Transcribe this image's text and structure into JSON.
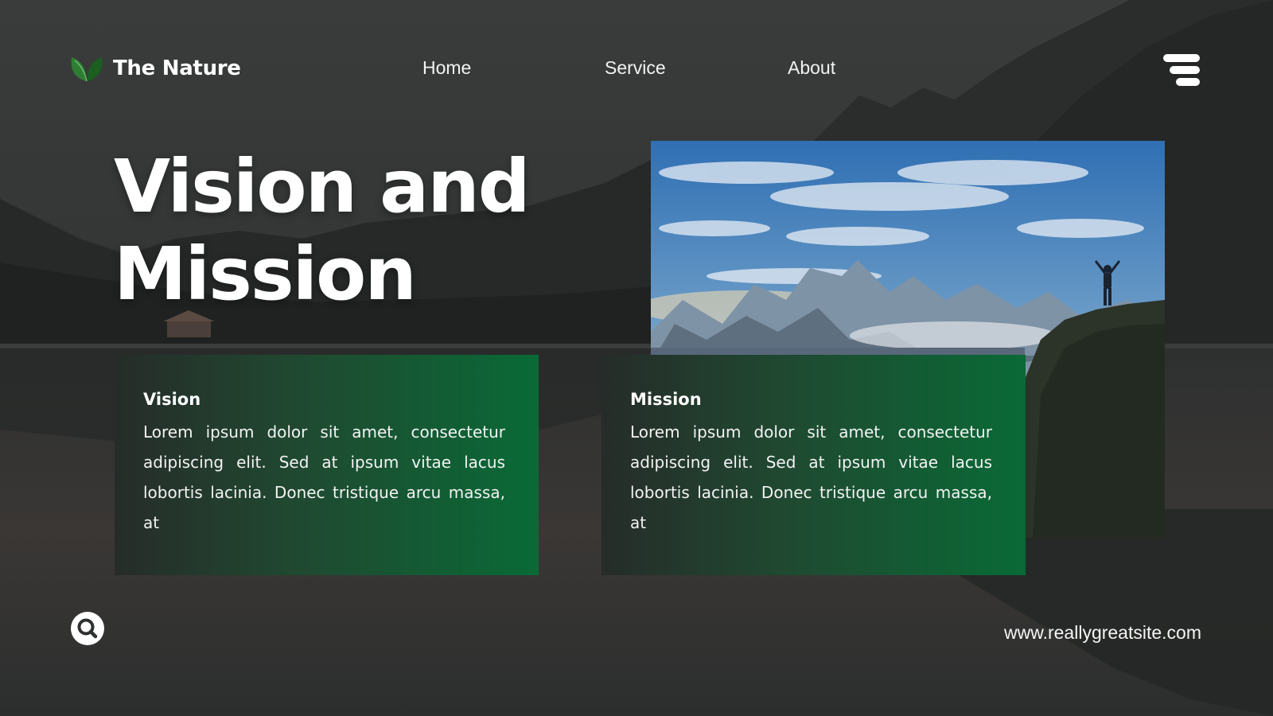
{
  "brand": {
    "name": "The Nature",
    "icon": "leaf-icon",
    "icon_colors": [
      "#2e7d32",
      "#66bb6a"
    ]
  },
  "nav": {
    "items": [
      "Home",
      "Service",
      "About"
    ]
  },
  "header": {
    "menu_icon": "menu-icon"
  },
  "hero": {
    "title_line1": "Vision and",
    "title_line2": "Mission"
  },
  "cards": [
    {
      "title": "Vision",
      "body": "Lorem ipsum dolor sit amet, consectetur adipiscing elit. Sed at ipsum vitae lacus lobortis lacinia. Donec tristique arcu massa, at"
    },
    {
      "title": "Mission",
      "body": "Lorem ipsum dolor sit amet, consectetur adipiscing elit. Sed at ipsum vitae lacus lobortis lacinia. Donec tristique arcu massa, at"
    }
  ],
  "footer": {
    "search_icon": "search-icon",
    "url": "www.reallygreatsite.com"
  },
  "colors": {
    "accent_green": "#096a36",
    "card_dark": "#262c29",
    "background": "#2f3131",
    "text": "#ffffff"
  }
}
